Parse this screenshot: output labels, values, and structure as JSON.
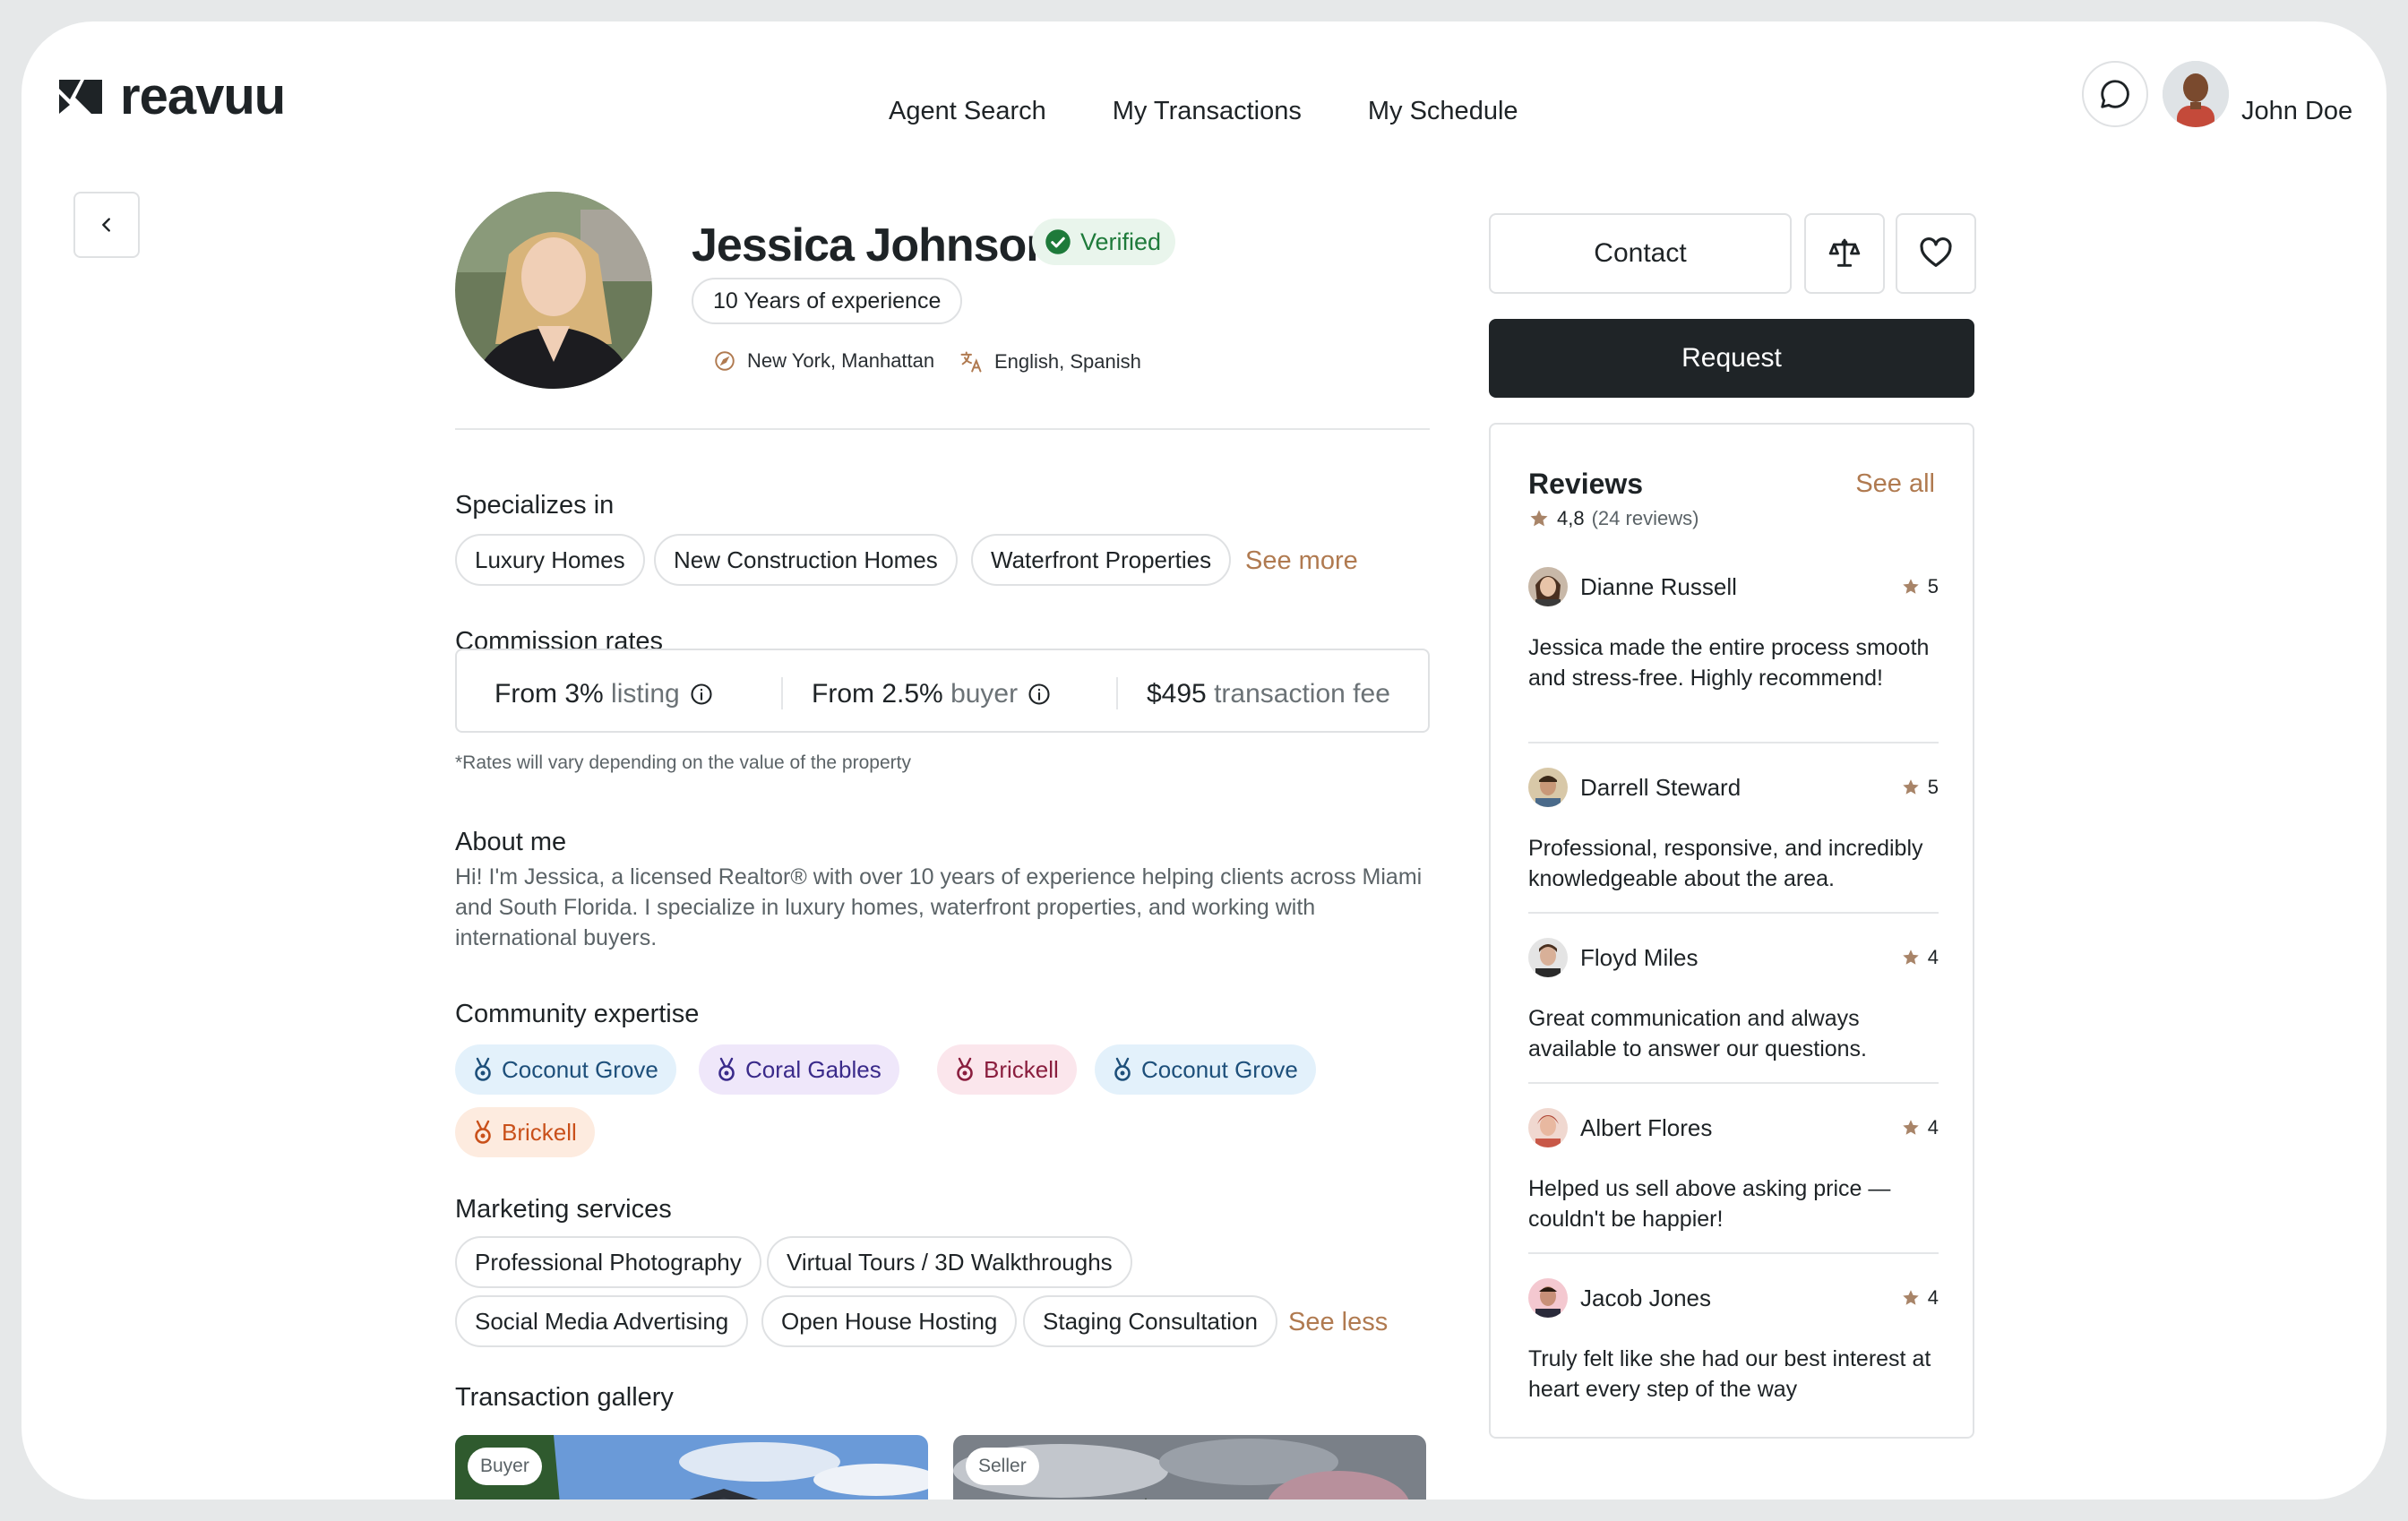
{
  "brand": {
    "name": "reavuu"
  },
  "nav": {
    "items": [
      "Agent Search",
      "My Transactions",
      "My Schedule"
    ]
  },
  "user": {
    "name": "John Doe"
  },
  "profile": {
    "name": "Jessica Johnson",
    "verified_label": "Verified",
    "experience": "10 Years of experience",
    "location": "New York, Manhattan",
    "languages": "English, Spanish"
  },
  "specializes": {
    "title": "Specializes in",
    "tags": [
      "Luxury Homes",
      "New Construction Homes",
      "Waterfront Properties"
    ],
    "see_more": "See more"
  },
  "commission": {
    "title": "Commission rates",
    "listing": {
      "value": "From 3%",
      "label": "listing"
    },
    "buyer": {
      "value": "From 2.5%",
      "label": "buyer"
    },
    "fee": {
      "value": "$495",
      "label": "transaction fee"
    },
    "note": "*Rates will vary depending on the value of the property"
  },
  "about": {
    "title": "About me",
    "text": "Hi! I'm Jessica, a licensed Realtor® with over 10 years of experience helping clients across Miami and South Florida. I specialize in luxury homes, waterfront properties, and working with international buyers."
  },
  "community": {
    "title": "Community expertise",
    "tags": [
      "Coconut Grove",
      "Coral Gables",
      "Brickell",
      "Coconut Grove",
      "Brickell"
    ]
  },
  "marketing": {
    "title": "Marketing services",
    "tags": [
      "Professional Photography",
      "Virtual Tours / 3D Walkthroughs",
      "Social Media Advertising",
      "Open House Hosting",
      "Staging Consultation"
    ],
    "see_less": "See less"
  },
  "gallery": {
    "title": "Transaction gallery",
    "items": [
      {
        "badge": "Buyer"
      },
      {
        "badge": "Seller"
      }
    ]
  },
  "actions": {
    "contact": "Contact",
    "request": "Request"
  },
  "reviews": {
    "title": "Reviews",
    "see_all": "See all",
    "rating": "4,8",
    "count": "(24 reviews)",
    "items": [
      {
        "name": "Dianne Russell",
        "stars": "5",
        "text": "Jessica made the entire process smooth and stress-free. Highly recommend!"
      },
      {
        "name": "Darrell Steward",
        "stars": "5",
        "text": "Professional, responsive, and incredibly knowledgeable about the area."
      },
      {
        "name": "Floyd Miles",
        "stars": "4",
        "text": "Great communication and always available to answer our questions."
      },
      {
        "name": "Albert Flores",
        "stars": "4",
        "text": "Helped us sell above asking price — couldn't be happier!"
      },
      {
        "name": "Jacob Jones",
        "stars": "4",
        "text": "Truly felt like she had our best interest at heart every step of the way"
      }
    ]
  },
  "colors": {
    "accent": "#b07a50",
    "primary_button": "#1f2427",
    "verified": "#1e7a3a",
    "star": "#a88468"
  },
  "icons": {
    "back": "chevron-left-icon",
    "chat": "chat-bubble-icon",
    "compare": "scale-icon",
    "favorite": "heart-icon",
    "location": "compass-icon",
    "language": "translate-icon",
    "info": "info-icon",
    "star": "star-icon",
    "medal": "medal-icon"
  }
}
